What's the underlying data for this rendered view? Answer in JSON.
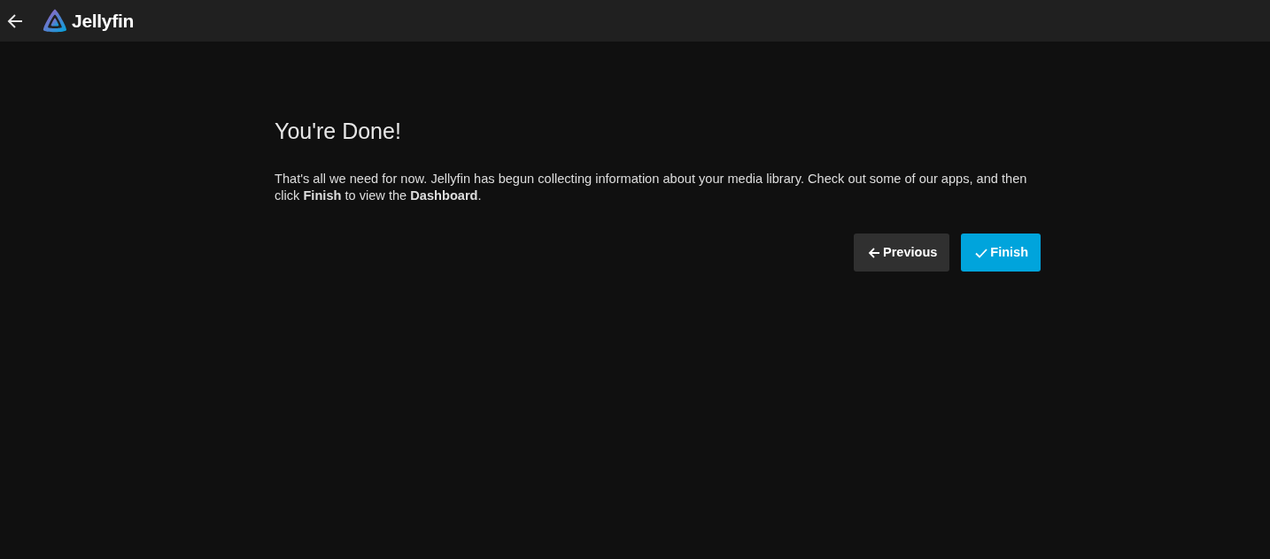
{
  "header": {
    "logo_text": "Jellyfin"
  },
  "page": {
    "title": "You're Done!",
    "message": "That's all we need for now. Jellyfin has begun collecting information about your media library. Check out some of our apps, and then click **Finish** to view the **Dashboard**."
  },
  "buttons": [
    {
      "label": "Previous",
      "kind": "previous"
    },
    {
      "label": "Finish",
      "kind": "finish"
    }
  ]
}
